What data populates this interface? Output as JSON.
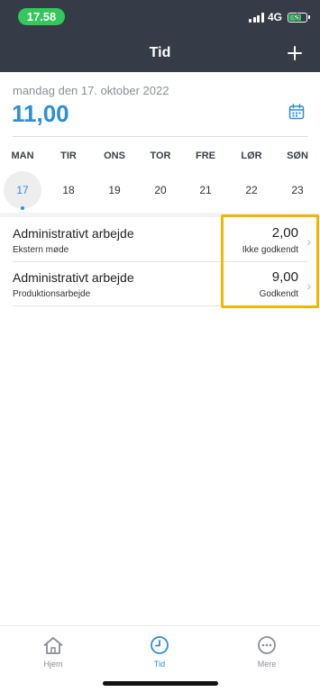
{
  "status_bar": {
    "time": "17.58",
    "network": "4G"
  },
  "header": {
    "title": "Tid"
  },
  "summary": {
    "date": "mandag den 17. oktober 2022",
    "total_hours": "11,00"
  },
  "week": {
    "days": [
      "MAN",
      "TIR",
      "ONS",
      "TOR",
      "FRE",
      "LØR",
      "SØN"
    ],
    "dates": [
      "17",
      "18",
      "19",
      "20",
      "21",
      "22",
      "23"
    ]
  },
  "entries": [
    {
      "title": "Administrativt arbejde",
      "subtitle": "Ekstern møde",
      "hours": "2,00",
      "status": "Ikke godkendt"
    },
    {
      "title": "Administrativt arbejde",
      "subtitle": "Produktionsarbejde",
      "hours": "9,00",
      "status": "Godkendt"
    }
  ],
  "tabs": [
    {
      "label": "Hjem",
      "icon": "home-icon"
    },
    {
      "label": "Tid",
      "icon": "clock-icon"
    },
    {
      "label": "Mere",
      "icon": "more-icon"
    }
  ],
  "colors": {
    "header": "#353c47",
    "accent": "#2a8fd8",
    "highlight": "#f2b600",
    "status_time": "#34c759"
  }
}
